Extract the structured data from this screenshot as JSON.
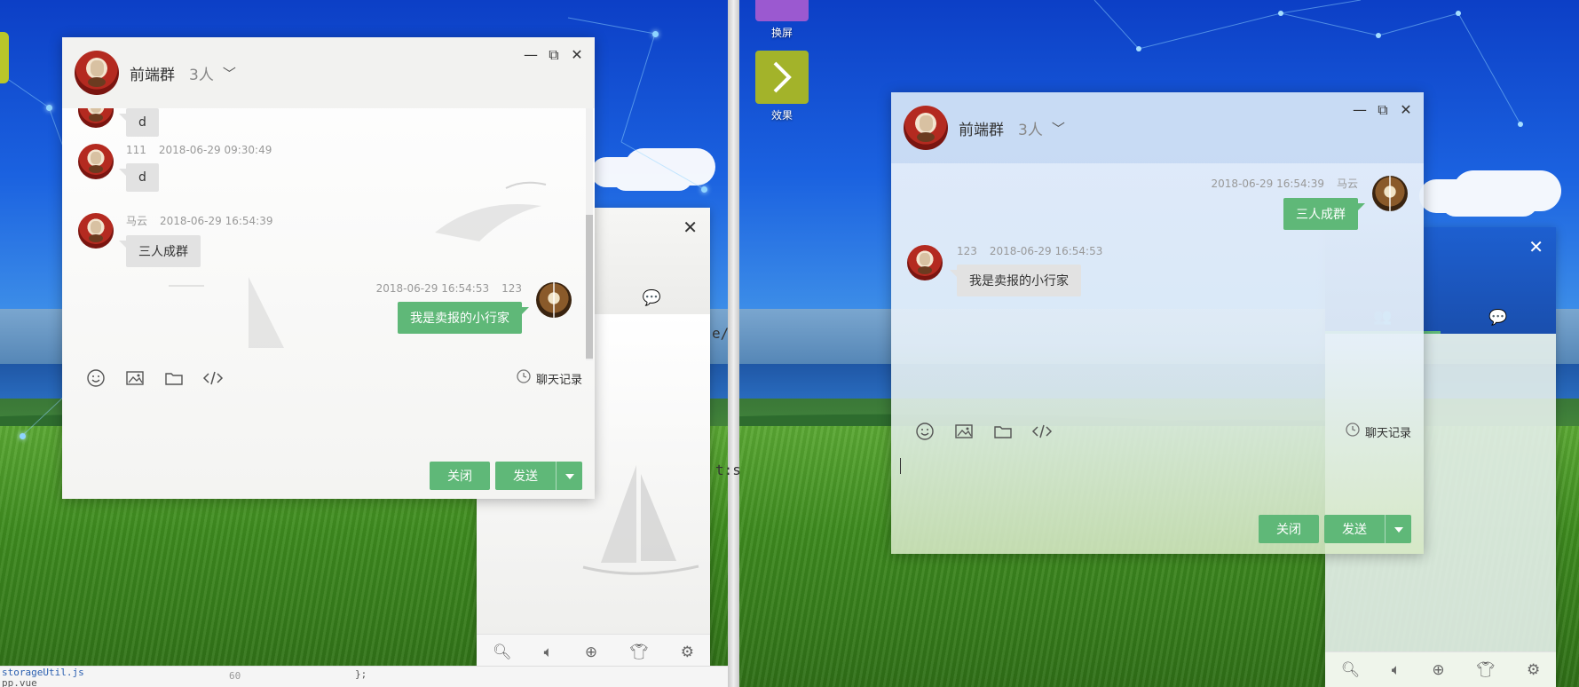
{
  "left_screen": {
    "chat": {
      "group_name": "前端群",
      "member_count": "3人",
      "messages": [
        {
          "user": "",
          "time": "",
          "text": "d",
          "side": "in"
        },
        {
          "user": "111",
          "time": "2018-06-29 09:30:49",
          "text": "d",
          "side": "in"
        },
        {
          "user": "马云",
          "time": "2018-06-29 16:54:39",
          "text": "三人成群",
          "side": "in"
        },
        {
          "user": "123",
          "time": "2018-06-29 16:54:53",
          "text": "我是卖报的小行家",
          "side": "out"
        }
      ],
      "history_label": "聊天记录",
      "close_label": "关闭",
      "send_label": "发送"
    }
  },
  "right_screen": {
    "desktop_icons": [
      {
        "label": "换屏",
        "color": "#9b59d0"
      },
      {
        "label": "效果",
        "color": "#a3b32a"
      }
    ],
    "chat": {
      "group_name": "前端群",
      "member_count": "3人",
      "messages": [
        {
          "user": "马云",
          "time": "2018-06-29 16:54:39",
          "text": "三人成群",
          "side": "out"
        },
        {
          "user": "123",
          "time": "2018-06-29 16:54:53",
          "text": "我是卖报的小行家",
          "side": "in"
        }
      ],
      "history_label": "聊天记录",
      "close_label": "关闭",
      "send_label": "发送"
    }
  },
  "editor": {
    "filename": "storageUtil.js",
    "line_number": "60",
    "code": "};",
    "path_fragment": "pp.vue",
    "peek_chars": [
      "e/",
      "t:s"
    ]
  },
  "colors": {
    "accent_green": "#5fb878",
    "bubble_gray": "#e2e2e2",
    "sky_blue": "#1b62e0"
  }
}
